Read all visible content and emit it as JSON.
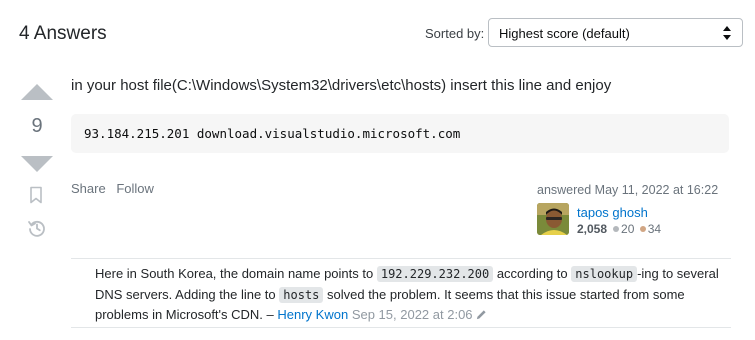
{
  "header": {
    "answers_count": "4 Answers",
    "sort_label": "Sorted by:",
    "sort_selected": "Highest score (default)"
  },
  "answer": {
    "score": "9",
    "text": "in your host file(C:\\Windows\\System32\\drivers\\etc\\hosts) insert this line and enjoy",
    "code": "93.184.215.201 download.visualstudio.microsoft.com",
    "share_label": "Share",
    "follow_label": "Follow",
    "answered": "answered May 11, 2022 at 16:22",
    "user": {
      "name": "tapos ghosh",
      "reputation": "2,058",
      "silver_badges": "20",
      "bronze_badges": "34"
    }
  },
  "comment": {
    "part1": "Here in South Korea, the domain name points to ",
    "code1": "192.229.232.200",
    "part2": " according to ",
    "code2": "nslookup",
    "part3": "-ing to several DNS servers. Adding the line to ",
    "code3": "hosts",
    "part4": " solved the problem. It seems that this issue started from some problems in Microsoft's CDN. – ",
    "author": "Henry Kwon",
    "date": "Sep 15, 2022 at 2:06"
  },
  "icons": {
    "vote_up": "triangle-up-icon",
    "vote_down": "triangle-down-icon",
    "bookmark": "bookmark-icon",
    "history": "history-icon",
    "edit": "pencil-icon",
    "sort": "chevron-updown-icon"
  },
  "colors": {
    "link": "#0074cc",
    "muted": "#6a737c",
    "vote_arrow": "#babfc4",
    "code_bg": "#f6f6f6"
  }
}
